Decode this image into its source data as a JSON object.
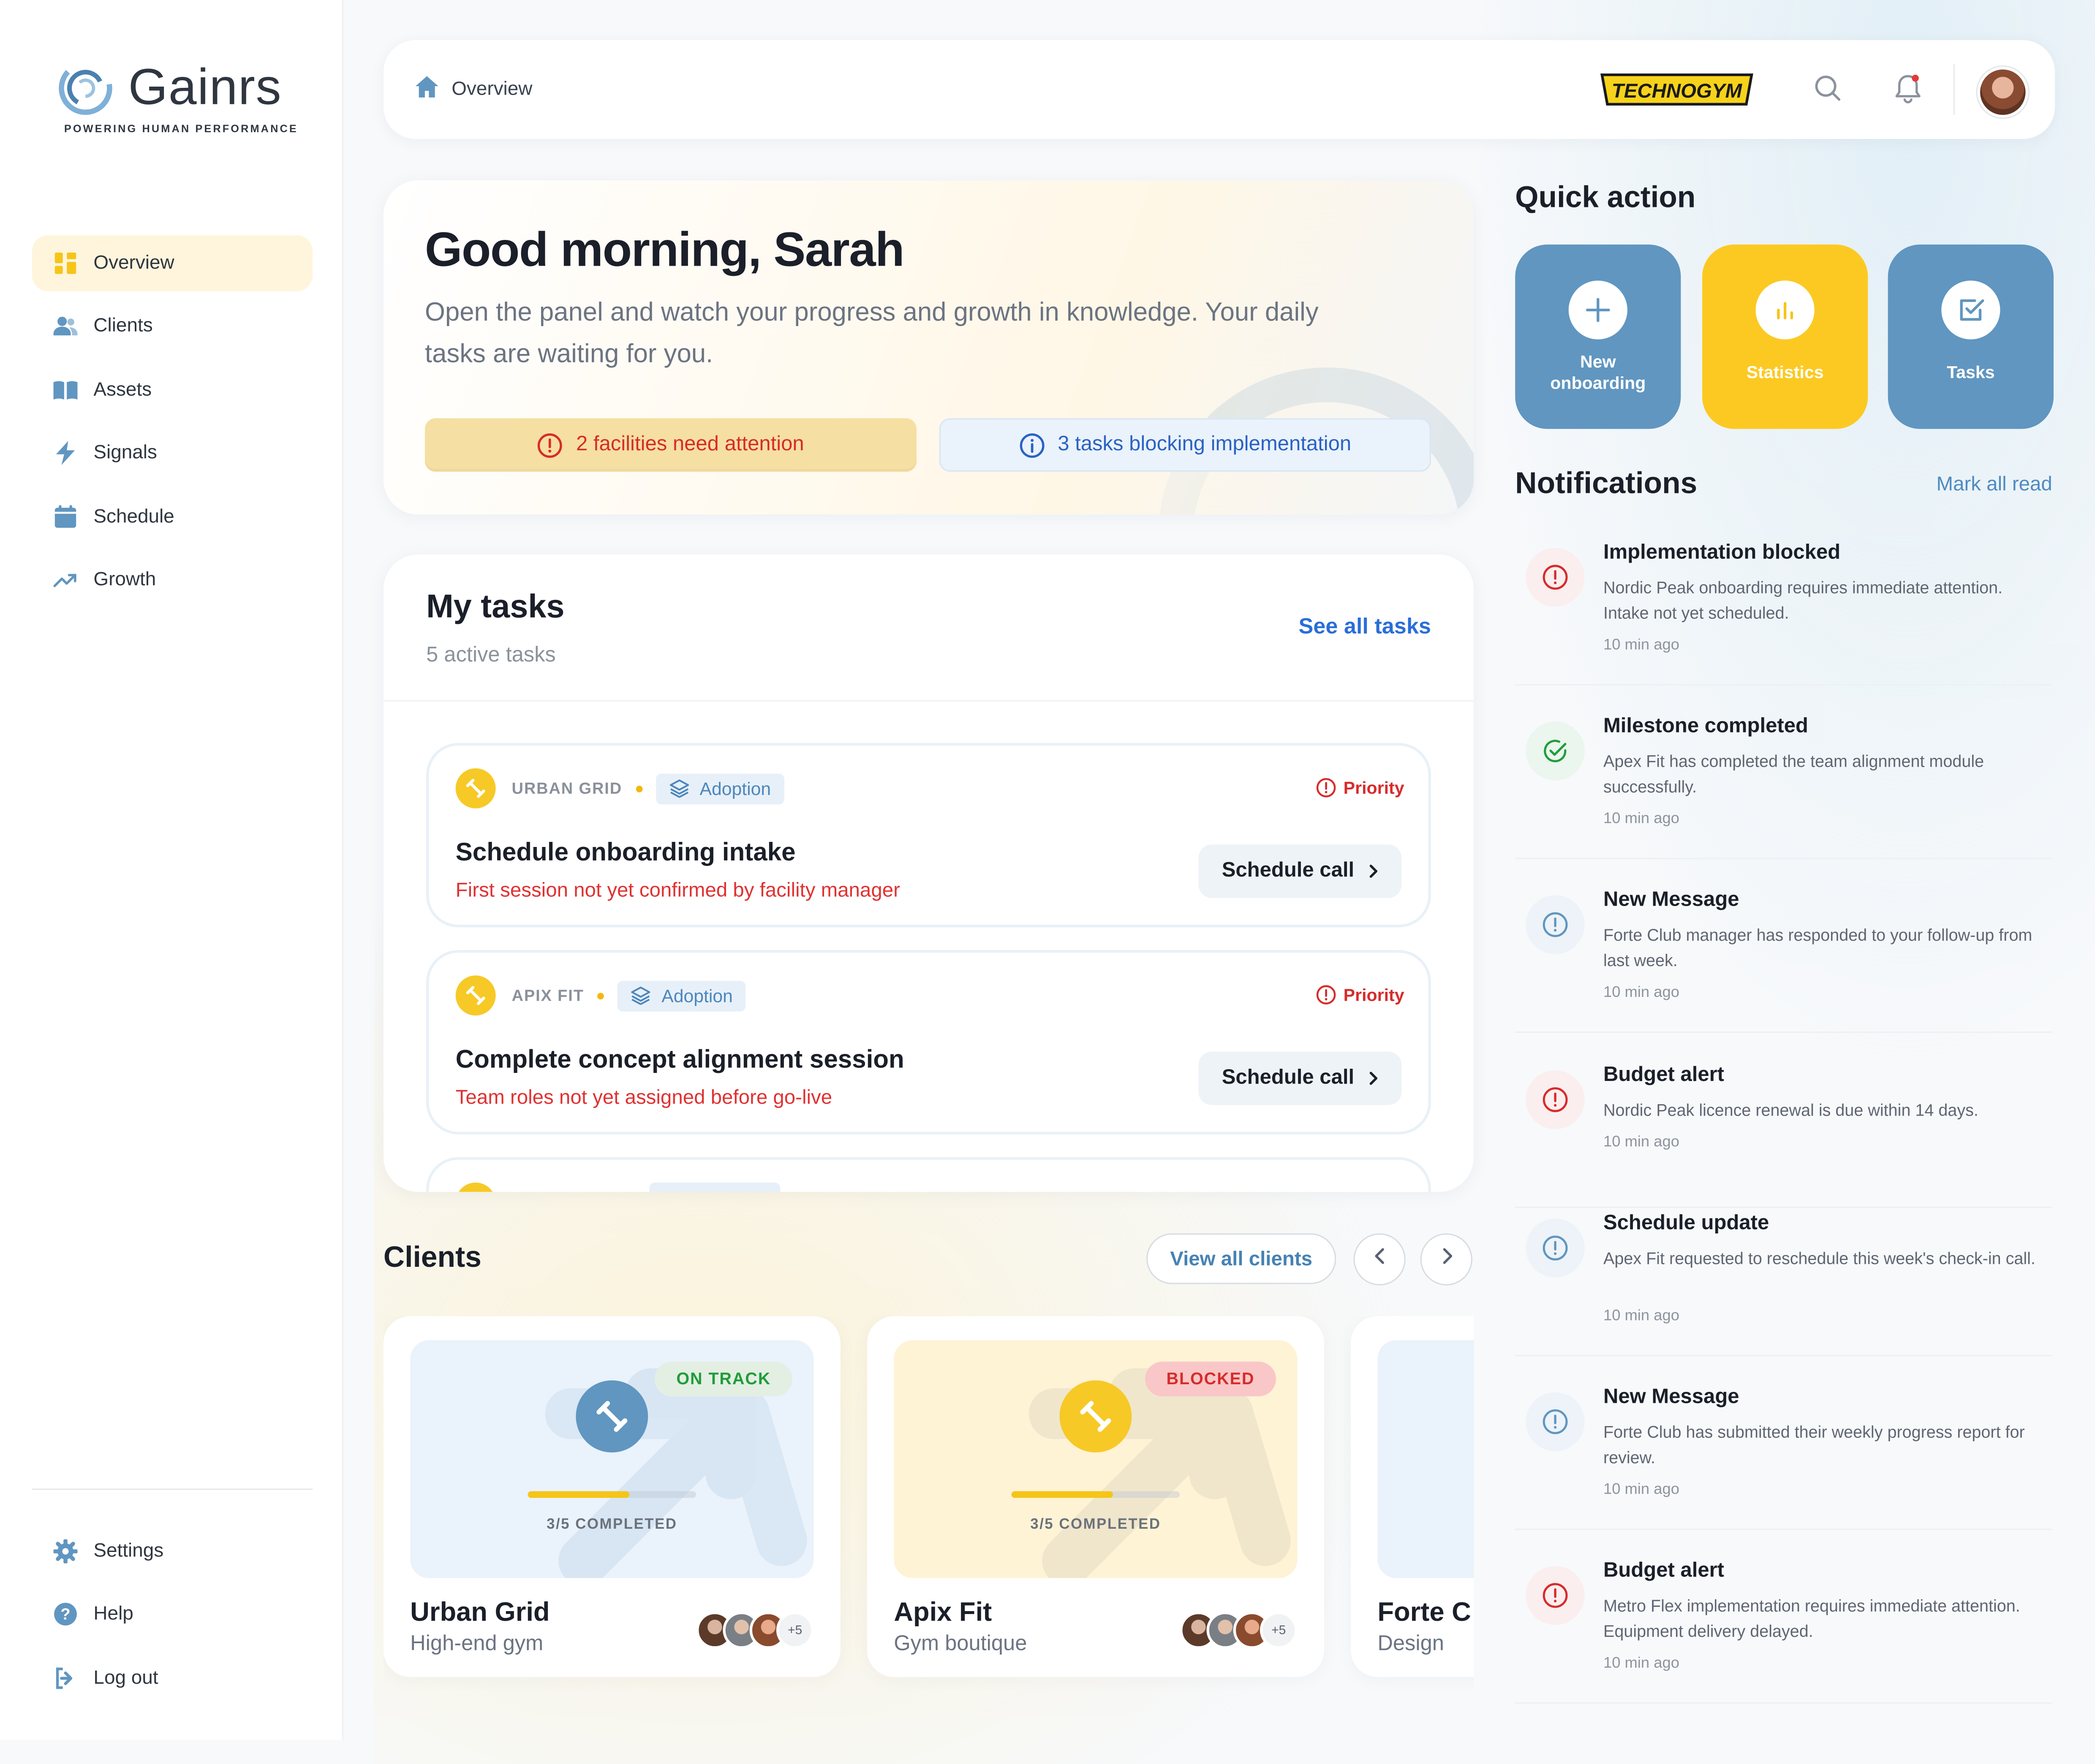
{
  "brand": {
    "name": "Gainrs",
    "tagline": "POWERING HUMAN PERFORMANCE",
    "accent_yellow": "#F7C926",
    "accent_blue": "#6096C0"
  },
  "sidebar": {
    "items": [
      {
        "label": "Overview",
        "icon": "grid-icon"
      },
      {
        "label": "Clients",
        "icon": "users-icon"
      },
      {
        "label": "Assets",
        "icon": "book-icon"
      },
      {
        "label": "Signals",
        "icon": "bolt-icon"
      },
      {
        "label": "Schedule",
        "icon": "calendar-icon"
      },
      {
        "label": "Growth",
        "icon": "trend-icon"
      }
    ],
    "bottom": [
      {
        "label": "Settings",
        "icon": "gear-icon"
      },
      {
        "label": "Help",
        "icon": "help-icon"
      },
      {
        "label": "Log out",
        "icon": "logout-icon"
      }
    ]
  },
  "topbar": {
    "breadcrumb": "Overview",
    "partner_logo": "TECHNOGYM"
  },
  "hero": {
    "greeting": "Good morning, Sarah",
    "subtitle": "Open the panel and watch your progress and growth in knowledge. Your daily tasks are waiting for you.",
    "attention": "2 facilities need attention",
    "blocking": "3 tasks blocking implementation"
  },
  "tasks": {
    "title": "My tasks",
    "count_label": "5 active tasks",
    "see_all": "See all tasks",
    "items": [
      {
        "client": "URBAN GRID",
        "tag": "Adoption",
        "priority": "Priority",
        "title": "Schedule onboarding intake",
        "desc": "First session not yet confirmed by facility manager",
        "action": "Schedule call"
      },
      {
        "client": "APIX FIT",
        "tag": "Adoption",
        "priority": "Priority",
        "title": "Complete concept alignment session",
        "desc": "Team roles not yet assigned before go-live",
        "action": "Schedule call"
      }
    ]
  },
  "clients": {
    "title": "Clients",
    "view_all": "View all clients",
    "items": [
      {
        "name": "Urban Grid",
        "type": "High-end gym",
        "status": "ON TRACK",
        "progress_label": "3/5 COMPLETED",
        "progress": 0.6,
        "more": "+5"
      },
      {
        "name": "Apix Fit",
        "type": "Gym boutique",
        "status": "BLOCKED",
        "progress_label": "3/5 COMPLETED",
        "progress": 0.6,
        "more": "+5"
      },
      {
        "name": "Forte C",
        "type": "Design"
      }
    ]
  },
  "quick_action": {
    "title": "Quick action",
    "items": [
      {
        "label_line1": "New",
        "label_line2": "onboarding",
        "icon": "plus-icon"
      },
      {
        "label": "Statistics",
        "icon": "bar-chart-icon"
      },
      {
        "label": "Tasks",
        "icon": "checkbox-icon"
      }
    ]
  },
  "notifications": {
    "title": "Notifications",
    "mark_all": "Mark all read",
    "items": [
      {
        "title": "Implementation blocked",
        "body": "Nordic Peak onboarding requires immediate attention. Intake not yet scheduled.",
        "time": "10 min ago",
        "kind": "alert"
      },
      {
        "title": "Milestone completed",
        "body": "Apex Fit has completed the team alignment module successfully.",
        "time": "10 min ago",
        "kind": "success"
      },
      {
        "title": "New Message",
        "body": "Forte Club manager has responded to your follow-up from last week.",
        "time": "10 min ago",
        "kind": "info"
      },
      {
        "title": "Budget alert",
        "body": "Nordic Peak licence renewal is due within 14 days.",
        "time": "10 min ago",
        "kind": "alert"
      },
      {
        "title": "Schedule update",
        "body": "Apex Fit requested to reschedule this week's check-in call.",
        "time": "10 min ago",
        "kind": "info"
      },
      {
        "title": "New Message",
        "body": "Forte Club has submitted their weekly progress report for review.",
        "time": "10 min ago",
        "kind": "info"
      },
      {
        "title": "Budget alert",
        "body": "Metro Flex implementation requires immediate attention. Equipment delivery delayed.",
        "time": "10 min ago",
        "kind": "alert"
      }
    ]
  }
}
